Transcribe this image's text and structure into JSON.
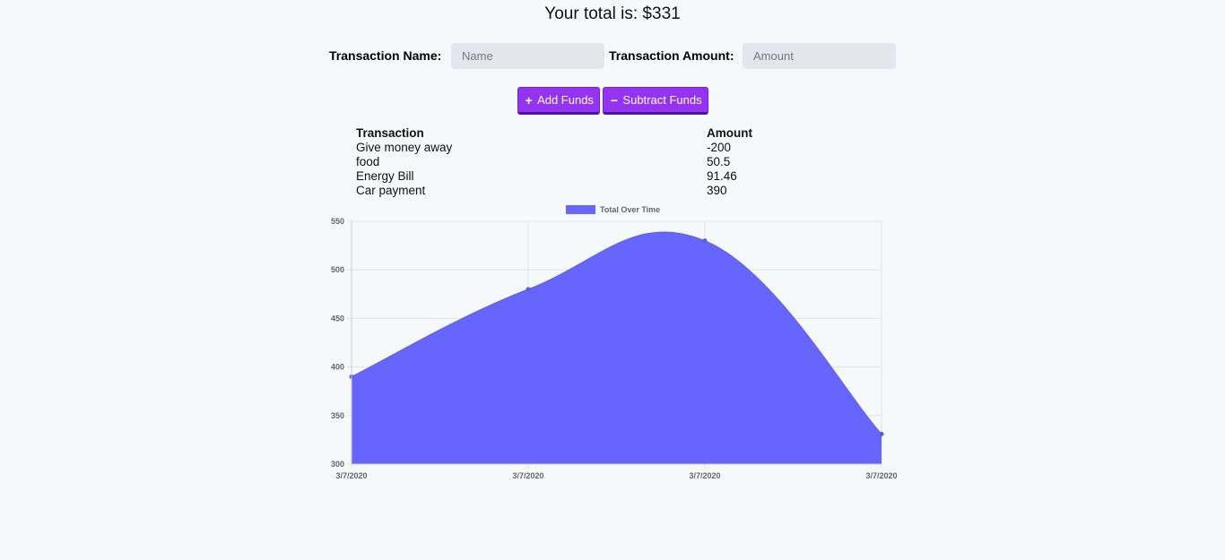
{
  "header": {
    "total_label": "Your total is: $331"
  },
  "form": {
    "name_label": "Transaction Name:",
    "name_placeholder": "Name",
    "amount_label": "Transaction Amount:",
    "amount_placeholder": "Amount"
  },
  "buttons": {
    "add_label": "Add Funds",
    "subtract_label": "Subtract Funds"
  },
  "table": {
    "headers": [
      "Transaction",
      "Amount"
    ],
    "rows": [
      {
        "name": "Give money away",
        "amount": "-200"
      },
      {
        "name": "food",
        "amount": "50.5"
      },
      {
        "name": "Energy Bill",
        "amount": "91.46"
      },
      {
        "name": "Car payment",
        "amount": "390"
      }
    ]
  },
  "colors": {
    "button": "#9433f2",
    "chart_fill": "#6666ff",
    "background": "#f5f9fc"
  },
  "chart_data": {
    "type": "area",
    "title": "",
    "xlabel": "",
    "ylabel": "",
    "categories": [
      "3/7/2020",
      "3/7/2020",
      "3/7/2020",
      "3/7/2020"
    ],
    "series": [
      {
        "name": "Total Over Time",
        "values": [
          390,
          480,
          530,
          331
        ]
      }
    ],
    "ylim": [
      300,
      550
    ],
    "yticks": [
      300,
      350,
      400,
      450,
      500,
      550
    ],
    "grid": true,
    "legend": "top-center"
  }
}
